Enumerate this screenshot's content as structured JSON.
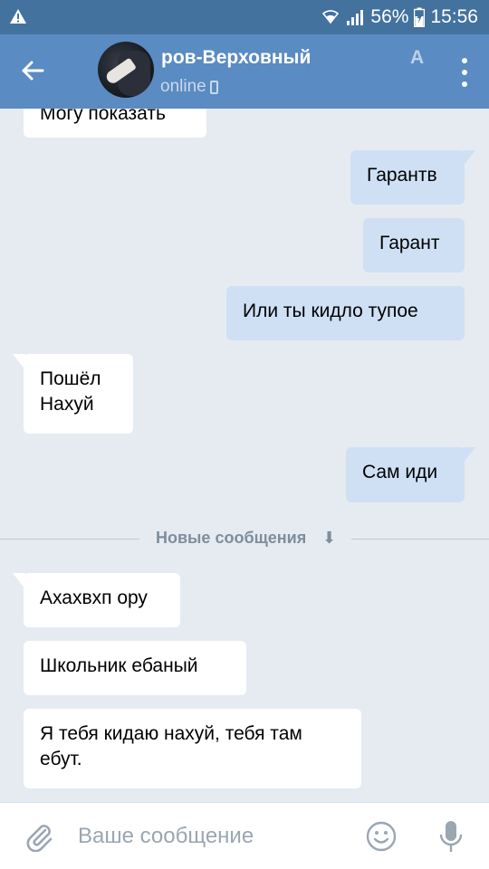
{
  "status_bar": {
    "battery": "56%",
    "time": "15:56"
  },
  "header": {
    "contact_name": "ров-Верховный",
    "contact_name_tail": "А",
    "status": "online"
  },
  "messages": [
    {
      "dir": "in",
      "text": "Могу показать"
    },
    {
      "dir": "out",
      "text": "Гарантв"
    },
    {
      "dir": "out",
      "text": "Гарант"
    },
    {
      "dir": "out",
      "text": "Или ты кидло тупое"
    },
    {
      "dir": "in",
      "line1": "Пошёл",
      "line2": "Нахуй"
    },
    {
      "dir": "out",
      "text": "Сам иди"
    },
    {
      "dir": "in",
      "text": "Ахахвхп ору"
    },
    {
      "dir": "in",
      "text": "Школьник ебаный"
    },
    {
      "dir": "in",
      "line1": "Я тебя кидаю нахуй, тебя там",
      "line2": "ебут."
    }
  ],
  "divider": {
    "label": "Новые сообщения",
    "arrow": "⬇"
  },
  "input": {
    "placeholder": "Ваше сообщение"
  },
  "colors": {
    "status_bar": "#44729f",
    "header": "#5a8bc2",
    "chat_bg": "#e5ebf1",
    "outgoing_bubble": "#cfe0f5",
    "incoming_bubble": "#ffffff"
  },
  "icons": [
    "warning-icon",
    "wifi-icon",
    "signal-icon",
    "battery-icon",
    "back-arrow-icon",
    "phone-icon",
    "more-menu-icon",
    "attach-icon",
    "smile-icon",
    "mic-icon"
  ]
}
